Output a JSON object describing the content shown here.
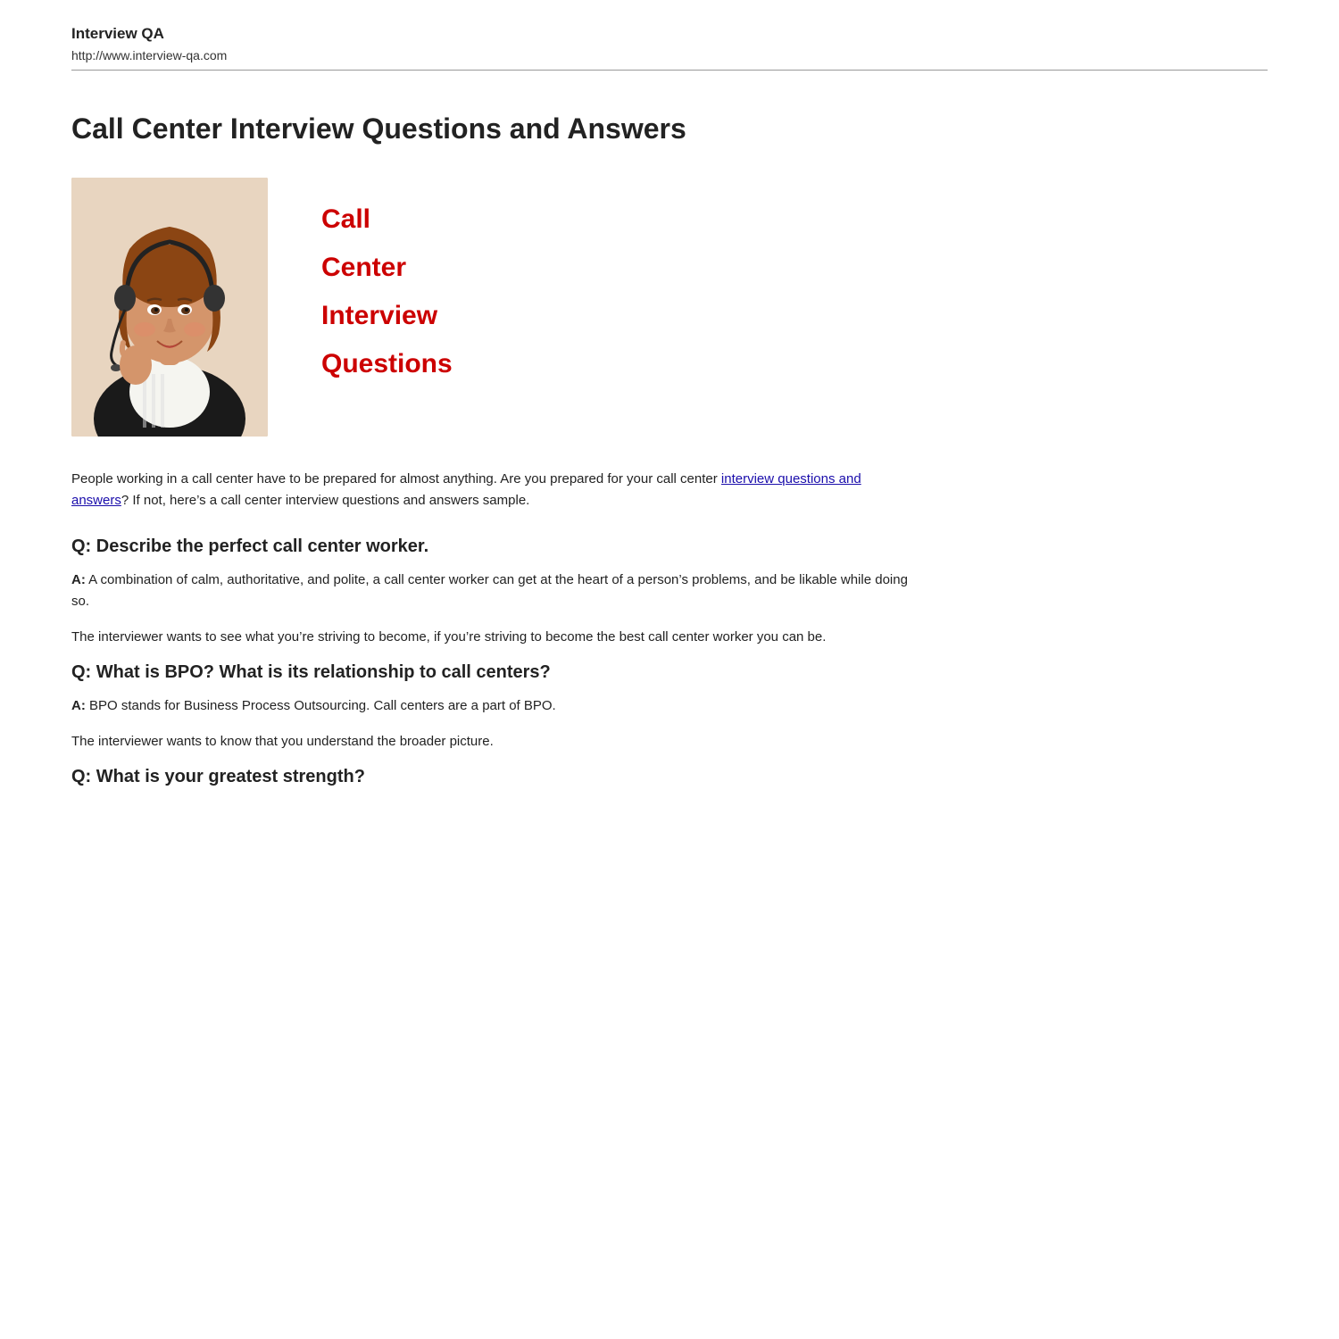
{
  "header": {
    "title": "Interview QA",
    "url": "http://www.interview-qa.com"
  },
  "page": {
    "title": "Call Center Interview Questions and Answers",
    "hero_words": [
      "Call",
      "Center",
      "Interview",
      "Questions"
    ],
    "intro": {
      "text_before_link": "People working in a call center have to be prepared for almost anything. Are you prepared for your call center ",
      "link_text": "interview questions and answers",
      "text_after_link": "? If not, here’s a call center interview questions and answers sample."
    },
    "qa_sections": [
      {
        "question": "Q: Describe the perfect call center worker.",
        "answer_bold_label": "A:",
        "answer_text": " A combination of calm, authoritative, and polite, a call center worker can get at the heart of a person’s problems, and be likable while doing so.",
        "follow_up": "The interviewer wants to see what you’re striving to become, if you’re striving to become the best call center worker you can be."
      },
      {
        "question": "Q: What is BPO? What is its relationship to call centers?",
        "answer_bold_label": "A:",
        "answer_text": " BPO stands for Business Process Outsourcing. Call centers are a part of BPO.",
        "follow_up": "The interviewer wants to know that you understand the broader picture."
      },
      {
        "question": "Q: What is your greatest strength?",
        "answer_bold_label": "",
        "answer_text": "",
        "follow_up": ""
      }
    ]
  }
}
